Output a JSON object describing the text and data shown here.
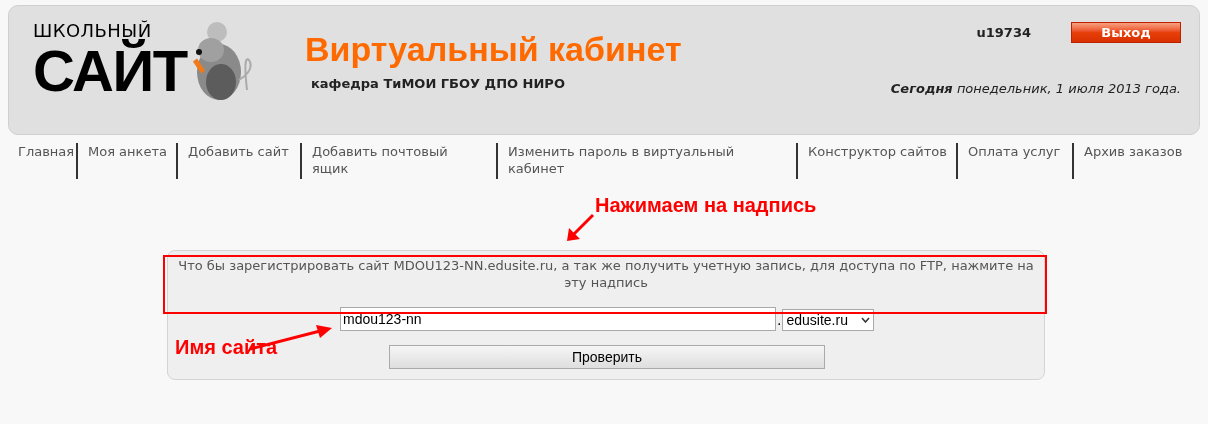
{
  "logo": {
    "top": "ШКОЛЬНЫЙ",
    "bottom": "САЙТ"
  },
  "header": {
    "title": "Виртуальный кабинет",
    "subtitle": "кафедра ТиМОИ ГБОУ ДПО НИРО",
    "user": "u19734",
    "logout": "Выход",
    "date_label": "Сегодня",
    "date": "понедельник, 1 июля 2013 года."
  },
  "nav": [
    {
      "label": "Главная"
    },
    {
      "label": "Моя анкета"
    },
    {
      "label": "Добавить сайт"
    },
    {
      "label": "Добавить почтовый ящик"
    },
    {
      "label": "Изменить пароль в виртуальный кабинет"
    },
    {
      "label": "Конструктор сайтов"
    },
    {
      "label": "Оплата услуг"
    },
    {
      "label": "Архив заказов"
    }
  ],
  "form": {
    "notice": "Что бы зарегистрировать сайт MDOU123-NN.edusite.ru, а так же получить учетную запись, для доступа по FTP, нажмите на эту надпись",
    "site_name": "mdou123-nn",
    "dot": ".",
    "domain": "edusite.ru",
    "check": "Проверить"
  },
  "annotations": [
    {
      "text": "Нажимаем на надпись"
    },
    {
      "text": "Имя сайта"
    }
  ]
}
